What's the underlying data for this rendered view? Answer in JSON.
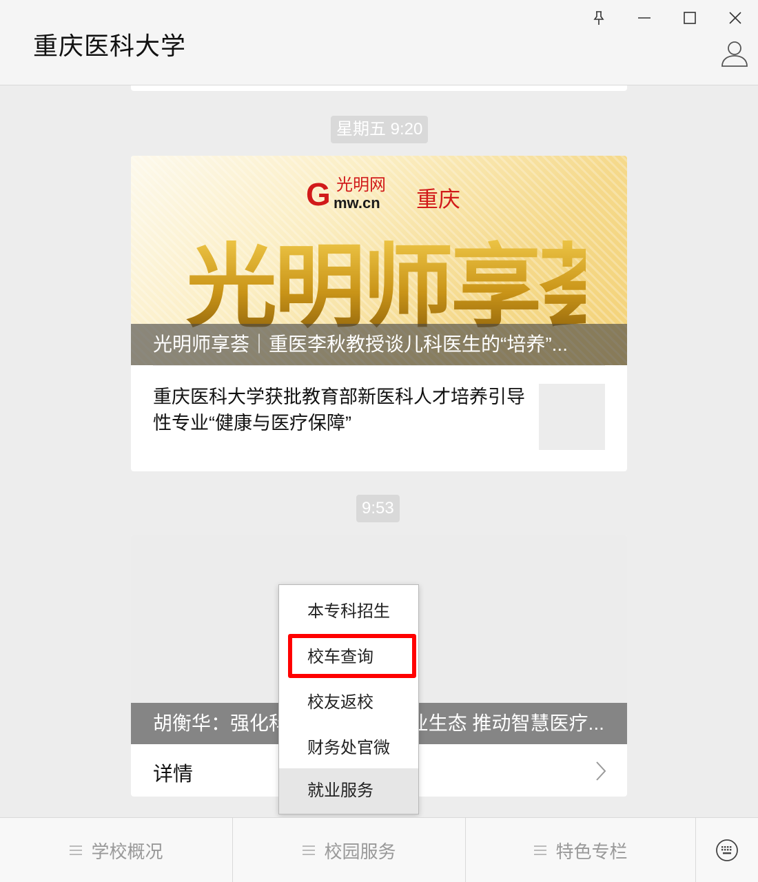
{
  "header": {
    "title": "重庆医科大学",
    "controls": [
      "pin-icon",
      "minimize-icon",
      "maximize-icon",
      "close-icon"
    ],
    "profile_icon": "user-icon"
  },
  "feed": {
    "time1": "星期五 9:20",
    "card1": {
      "logo_text": "光明网",
      "logo_domain": "mw.cn",
      "logo_city": "重庆",
      "calligraphy": "光明师享荟",
      "caption": "光明师享荟｜重医李秋教授谈儿科医生的“培养”...",
      "sub_item": "重庆医科大学获批教育部新医科人才培养引导性专业“健康与医疗保障”"
    },
    "time2": "9:53",
    "card2": {
      "caption": "胡衡华：强化科技创新 优化产业生态 推动智慧医疗...",
      "detail": "详情"
    }
  },
  "popup_menu": {
    "items": [
      "本专科招生",
      "校车查询",
      "校友返校",
      "财务处官微",
      "就业服务"
    ],
    "highlighted_item": "校车查询",
    "hovered_item": "就业服务"
  },
  "bottom_menu": {
    "tabs": [
      "学校概况",
      "校园服务",
      "特色专栏"
    ],
    "keyboard_icon": "keyboard-icon"
  },
  "colors": {
    "highlight": "#ff0000",
    "badge": "#d9d9d9",
    "caption_overlay": "#464646",
    "background": "#ededed"
  }
}
